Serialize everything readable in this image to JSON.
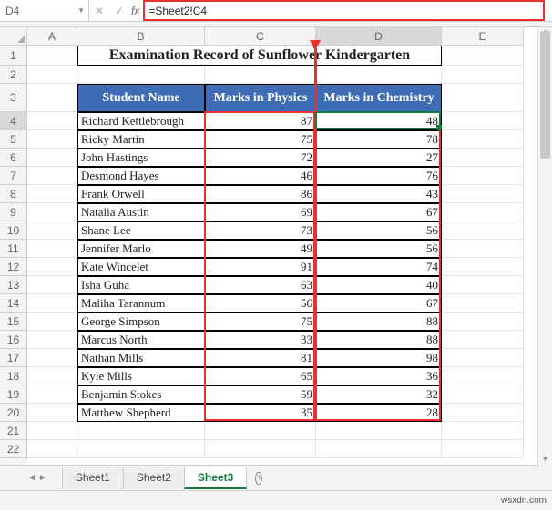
{
  "namebox": {
    "value": "D4"
  },
  "fxbar": {
    "cancel_icon": "✕",
    "confirm_icon": "✓",
    "fx_label": "fx",
    "formula": "=Sheet2!C4"
  },
  "columns": [
    {
      "letter": "A",
      "width_class": "wA",
      "active": false
    },
    {
      "letter": "B",
      "width_class": "wB",
      "active": false
    },
    {
      "letter": "C",
      "width_class": "wC",
      "active": false
    },
    {
      "letter": "D",
      "width_class": "wD",
      "active": true
    },
    {
      "letter": "E",
      "width_class": "wE",
      "active": false
    }
  ],
  "row_numbers": [
    1,
    2,
    3,
    4,
    5,
    6,
    7,
    8,
    9,
    10,
    11,
    12,
    13,
    14,
    15,
    16,
    17,
    18,
    19,
    20,
    21,
    22
  ],
  "active_row": 4,
  "title": "Examination Record of Sunflower Kindergarten",
  "headers": {
    "name": "Student Name",
    "physics": "Marks in Physics",
    "chemistry": "Marks in Chemistry"
  },
  "chart_data": {
    "type": "table",
    "columns": [
      "Student Name",
      "Marks in Physics",
      "Marks in Chemistry"
    ],
    "rows": [
      [
        "Richard Kettlebrough",
        87,
        48
      ],
      [
        "Ricky Martin",
        75,
        78
      ],
      [
        "John Hastings",
        72,
        27
      ],
      [
        "Desmond Hayes",
        46,
        76
      ],
      [
        "Frank Orwell",
        86,
        43
      ],
      [
        "Natalia Austin",
        69,
        67
      ],
      [
        "Shane Lee",
        73,
        56
      ],
      [
        "Jennifer Marlo",
        49,
        56
      ],
      [
        "Kate Wincelet",
        91,
        74
      ],
      [
        "Isha Guha",
        63,
        40
      ],
      [
        "Maliha Tarannum",
        56,
        67
      ],
      [
        "George Simpson",
        75,
        88
      ],
      [
        "Marcus North",
        33,
        88
      ],
      [
        "Nathan Mills",
        81,
        98
      ],
      [
        "Kyle Mills",
        65,
        36
      ],
      [
        "Benjamin Stokes",
        59,
        32
      ],
      [
        "Matthew Shepherd",
        35,
        28
      ]
    ]
  },
  "tabs": {
    "items": [
      "Sheet1",
      "Sheet2",
      "Sheet3"
    ],
    "active_index": 2,
    "add_icon": "+"
  },
  "watermark": "wsxdn.com"
}
